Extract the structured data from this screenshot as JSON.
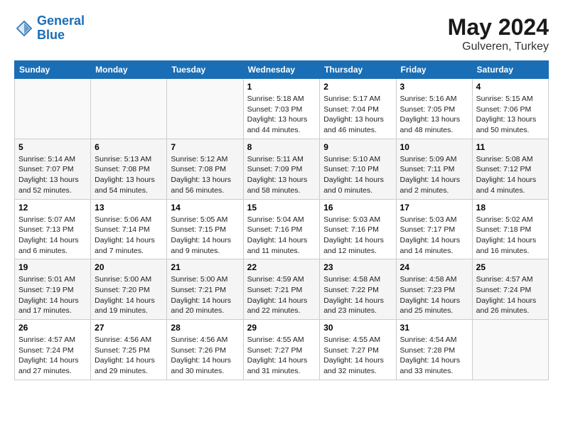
{
  "header": {
    "logo_line1": "General",
    "logo_line2": "Blue",
    "month_year": "May 2024",
    "location": "Gulveren, Turkey"
  },
  "weekdays": [
    "Sunday",
    "Monday",
    "Tuesday",
    "Wednesday",
    "Thursday",
    "Friday",
    "Saturday"
  ],
  "weeks": [
    [
      {
        "day": "",
        "content": ""
      },
      {
        "day": "",
        "content": ""
      },
      {
        "day": "",
        "content": ""
      },
      {
        "day": "1",
        "content": "Sunrise: 5:18 AM\nSunset: 7:03 PM\nDaylight: 13 hours and 44 minutes."
      },
      {
        "day": "2",
        "content": "Sunrise: 5:17 AM\nSunset: 7:04 PM\nDaylight: 13 hours and 46 minutes."
      },
      {
        "day": "3",
        "content": "Sunrise: 5:16 AM\nSunset: 7:05 PM\nDaylight: 13 hours and 48 minutes."
      },
      {
        "day": "4",
        "content": "Sunrise: 5:15 AM\nSunset: 7:06 PM\nDaylight: 13 hours and 50 minutes."
      }
    ],
    [
      {
        "day": "5",
        "content": "Sunrise: 5:14 AM\nSunset: 7:07 PM\nDaylight: 13 hours and 52 minutes."
      },
      {
        "day": "6",
        "content": "Sunrise: 5:13 AM\nSunset: 7:08 PM\nDaylight: 13 hours and 54 minutes."
      },
      {
        "day": "7",
        "content": "Sunrise: 5:12 AM\nSunset: 7:08 PM\nDaylight: 13 hours and 56 minutes."
      },
      {
        "day": "8",
        "content": "Sunrise: 5:11 AM\nSunset: 7:09 PM\nDaylight: 13 hours and 58 minutes."
      },
      {
        "day": "9",
        "content": "Sunrise: 5:10 AM\nSunset: 7:10 PM\nDaylight: 14 hours and 0 minutes."
      },
      {
        "day": "10",
        "content": "Sunrise: 5:09 AM\nSunset: 7:11 PM\nDaylight: 14 hours and 2 minutes."
      },
      {
        "day": "11",
        "content": "Sunrise: 5:08 AM\nSunset: 7:12 PM\nDaylight: 14 hours and 4 minutes."
      }
    ],
    [
      {
        "day": "12",
        "content": "Sunrise: 5:07 AM\nSunset: 7:13 PM\nDaylight: 14 hours and 6 minutes."
      },
      {
        "day": "13",
        "content": "Sunrise: 5:06 AM\nSunset: 7:14 PM\nDaylight: 14 hours and 7 minutes."
      },
      {
        "day": "14",
        "content": "Sunrise: 5:05 AM\nSunset: 7:15 PM\nDaylight: 14 hours and 9 minutes."
      },
      {
        "day": "15",
        "content": "Sunrise: 5:04 AM\nSunset: 7:16 PM\nDaylight: 14 hours and 11 minutes."
      },
      {
        "day": "16",
        "content": "Sunrise: 5:03 AM\nSunset: 7:16 PM\nDaylight: 14 hours and 12 minutes."
      },
      {
        "day": "17",
        "content": "Sunrise: 5:03 AM\nSunset: 7:17 PM\nDaylight: 14 hours and 14 minutes."
      },
      {
        "day": "18",
        "content": "Sunrise: 5:02 AM\nSunset: 7:18 PM\nDaylight: 14 hours and 16 minutes."
      }
    ],
    [
      {
        "day": "19",
        "content": "Sunrise: 5:01 AM\nSunset: 7:19 PM\nDaylight: 14 hours and 17 minutes."
      },
      {
        "day": "20",
        "content": "Sunrise: 5:00 AM\nSunset: 7:20 PM\nDaylight: 14 hours and 19 minutes."
      },
      {
        "day": "21",
        "content": "Sunrise: 5:00 AM\nSunset: 7:21 PM\nDaylight: 14 hours and 20 minutes."
      },
      {
        "day": "22",
        "content": "Sunrise: 4:59 AM\nSunset: 7:21 PM\nDaylight: 14 hours and 22 minutes."
      },
      {
        "day": "23",
        "content": "Sunrise: 4:58 AM\nSunset: 7:22 PM\nDaylight: 14 hours and 23 minutes."
      },
      {
        "day": "24",
        "content": "Sunrise: 4:58 AM\nSunset: 7:23 PM\nDaylight: 14 hours and 25 minutes."
      },
      {
        "day": "25",
        "content": "Sunrise: 4:57 AM\nSunset: 7:24 PM\nDaylight: 14 hours and 26 minutes."
      }
    ],
    [
      {
        "day": "26",
        "content": "Sunrise: 4:57 AM\nSunset: 7:24 PM\nDaylight: 14 hours and 27 minutes."
      },
      {
        "day": "27",
        "content": "Sunrise: 4:56 AM\nSunset: 7:25 PM\nDaylight: 14 hours and 29 minutes."
      },
      {
        "day": "28",
        "content": "Sunrise: 4:56 AM\nSunset: 7:26 PM\nDaylight: 14 hours and 30 minutes."
      },
      {
        "day": "29",
        "content": "Sunrise: 4:55 AM\nSunset: 7:27 PM\nDaylight: 14 hours and 31 minutes."
      },
      {
        "day": "30",
        "content": "Sunrise: 4:55 AM\nSunset: 7:27 PM\nDaylight: 14 hours and 32 minutes."
      },
      {
        "day": "31",
        "content": "Sunrise: 4:54 AM\nSunset: 7:28 PM\nDaylight: 14 hours and 33 minutes."
      },
      {
        "day": "",
        "content": ""
      }
    ]
  ]
}
